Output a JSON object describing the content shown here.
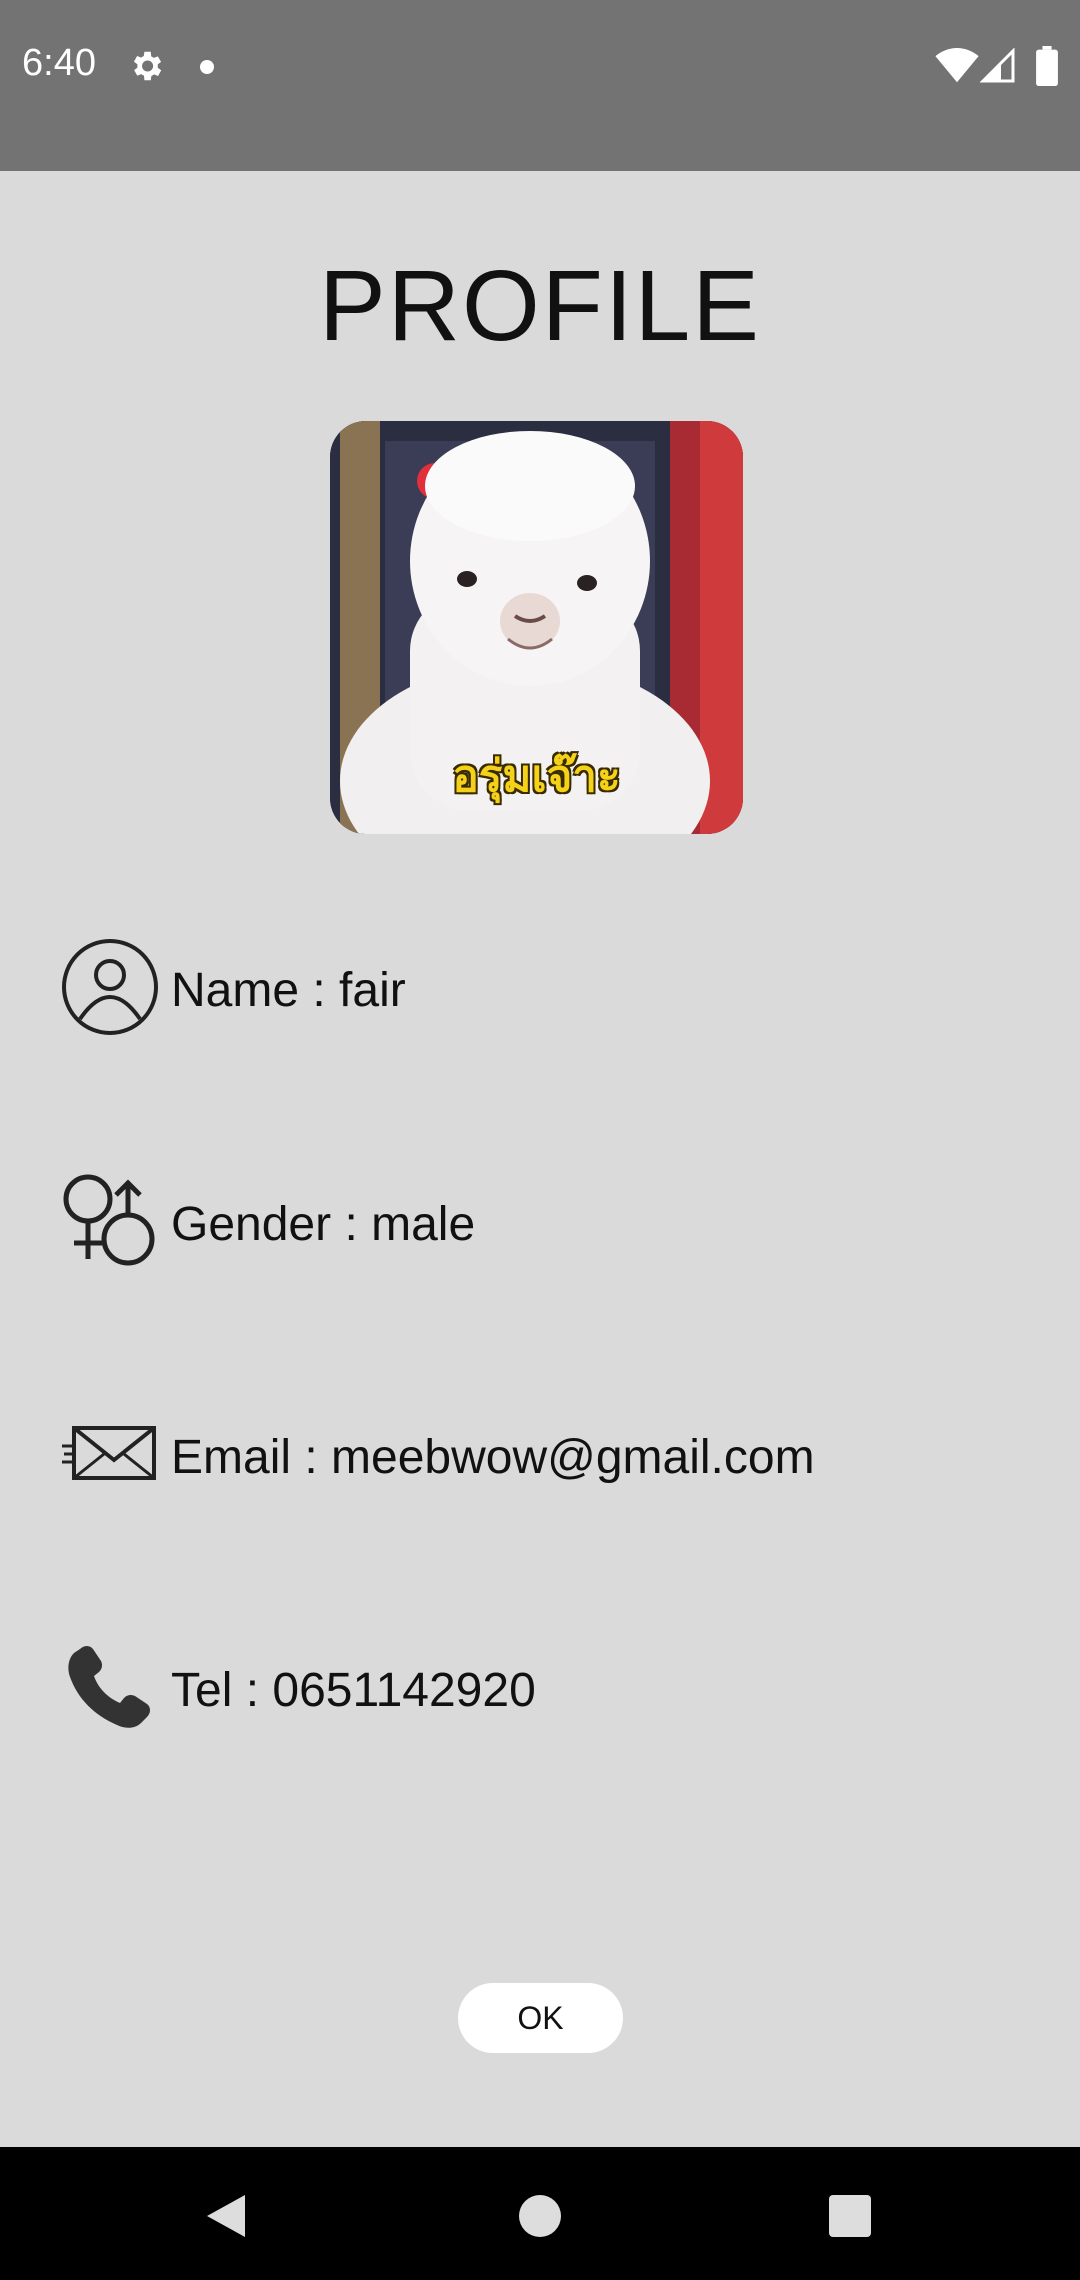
{
  "status_bar": {
    "time": "6:40",
    "icons": [
      "gear-icon",
      "dot-icon",
      "wifi-icon",
      "signal-icon",
      "battery-icon"
    ],
    "background": "#737373"
  },
  "page": {
    "title": "PROFILE",
    "avatar_caption": "อรุ่มเจ๊าะ",
    "background": "#dadada"
  },
  "profile": {
    "name": "Name : fair",
    "gender": "Gender : male",
    "email": "Email :  meebwow@gmail.com",
    "tel": "Tel : 0651142920"
  },
  "actions": {
    "ok_label": "OK"
  },
  "nav_bar": {
    "icons": [
      "back-icon",
      "home-icon",
      "recents-icon"
    ]
  }
}
